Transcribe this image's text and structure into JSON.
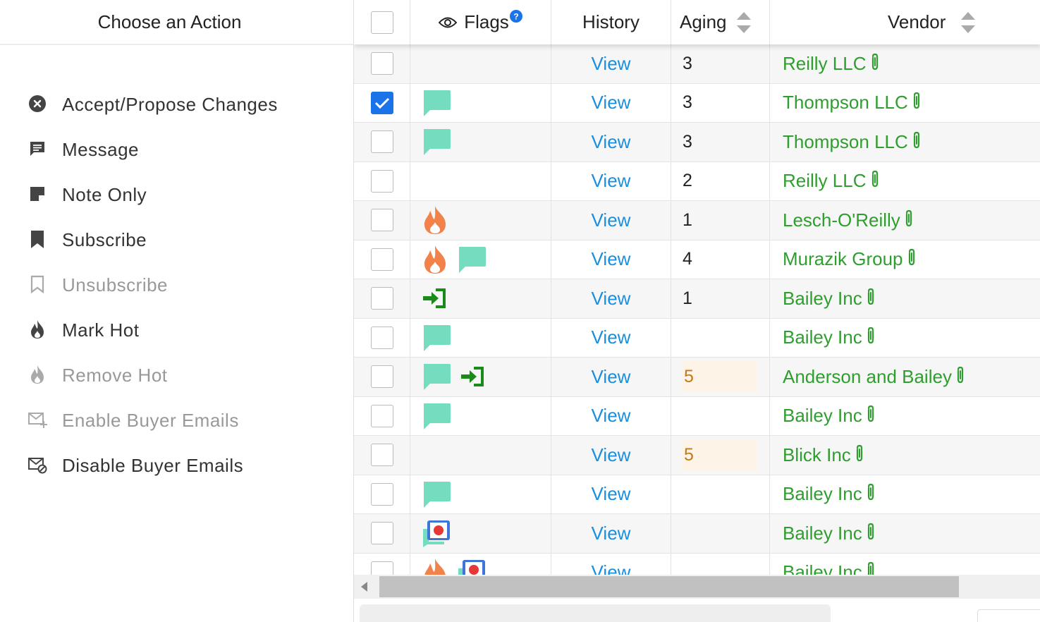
{
  "panel": {
    "title": "Choose an Action",
    "actions": [
      {
        "label": "Accept/Propose Changes",
        "icon": "close-circle-icon",
        "enabled": true
      },
      {
        "label": "Message",
        "icon": "message-icon",
        "enabled": true
      },
      {
        "label": "Note Only",
        "icon": "note-icon",
        "enabled": true
      },
      {
        "label": "Subscribe",
        "icon": "bookmark-icon",
        "enabled": true
      },
      {
        "label": "Unsubscribe",
        "icon": "bookmark-outline-icon",
        "enabled": false
      },
      {
        "label": "Mark Hot",
        "icon": "fire-icon",
        "enabled": true
      },
      {
        "label": "Remove Hot",
        "icon": "fire-icon",
        "enabled": false
      },
      {
        "label": "Enable Buyer Emails",
        "icon": "email-plus-icon",
        "enabled": false
      },
      {
        "label": "Disable Buyer Emails",
        "icon": "email-cancel-icon",
        "enabled": true
      }
    ]
  },
  "grid": {
    "headers": {
      "flags": "Flags",
      "history": "History",
      "aging": "Aging",
      "vendor": "Vendor"
    },
    "view_label": "View",
    "colors": {
      "link": "#1a8fdf",
      "vendor": "#2e9e2e",
      "comment": "#74dcbf",
      "fire": "#f0824a",
      "arrow": "#1a8a1a",
      "check": "#1a73e8"
    },
    "rows": [
      {
        "checked": false,
        "flags": [],
        "aging": "3",
        "aging_hl": false,
        "vendor": "Reilly LLC"
      },
      {
        "checked": true,
        "flags": [
          "comment"
        ],
        "aging": "3",
        "aging_hl": false,
        "vendor": "Thompson LLC"
      },
      {
        "checked": false,
        "flags": [
          "comment"
        ],
        "aging": "3",
        "aging_hl": false,
        "vendor": "Thompson LLC"
      },
      {
        "checked": false,
        "flags": [],
        "aging": "2",
        "aging_hl": false,
        "vendor": "Reilly LLC"
      },
      {
        "checked": false,
        "flags": [
          "fire"
        ],
        "aging": "1",
        "aging_hl": false,
        "vendor": "Lesch-O'Reilly"
      },
      {
        "checked": false,
        "flags": [
          "fire",
          "comment"
        ],
        "aging": "4",
        "aging_hl": false,
        "vendor": "Murazik Group"
      },
      {
        "checked": false,
        "flags": [
          "login"
        ],
        "aging": "1",
        "aging_hl": false,
        "vendor": "Bailey Inc"
      },
      {
        "checked": false,
        "flags": [
          "comment"
        ],
        "aging": "",
        "aging_hl": false,
        "vendor": "Bailey Inc"
      },
      {
        "checked": false,
        "flags": [
          "comment",
          "login"
        ],
        "aging": "5",
        "aging_hl": true,
        "vendor": "Anderson and Bailey"
      },
      {
        "checked": false,
        "flags": [
          "comment"
        ],
        "aging": "",
        "aging_hl": false,
        "vendor": "Bailey Inc"
      },
      {
        "checked": false,
        "flags": [],
        "aging": "5",
        "aging_hl": true,
        "vendor": "Blick Inc"
      },
      {
        "checked": false,
        "flags": [
          "comment"
        ],
        "aging": "",
        "aging_hl": false,
        "vendor": "Bailey Inc"
      },
      {
        "checked": false,
        "flags": [
          "record"
        ],
        "aging": "",
        "aging_hl": false,
        "vendor": "Bailey Inc"
      },
      {
        "checked": false,
        "flags": [
          "fire",
          "record"
        ],
        "aging": "",
        "aging_hl": false,
        "vendor": "Bailey Inc"
      }
    ]
  }
}
